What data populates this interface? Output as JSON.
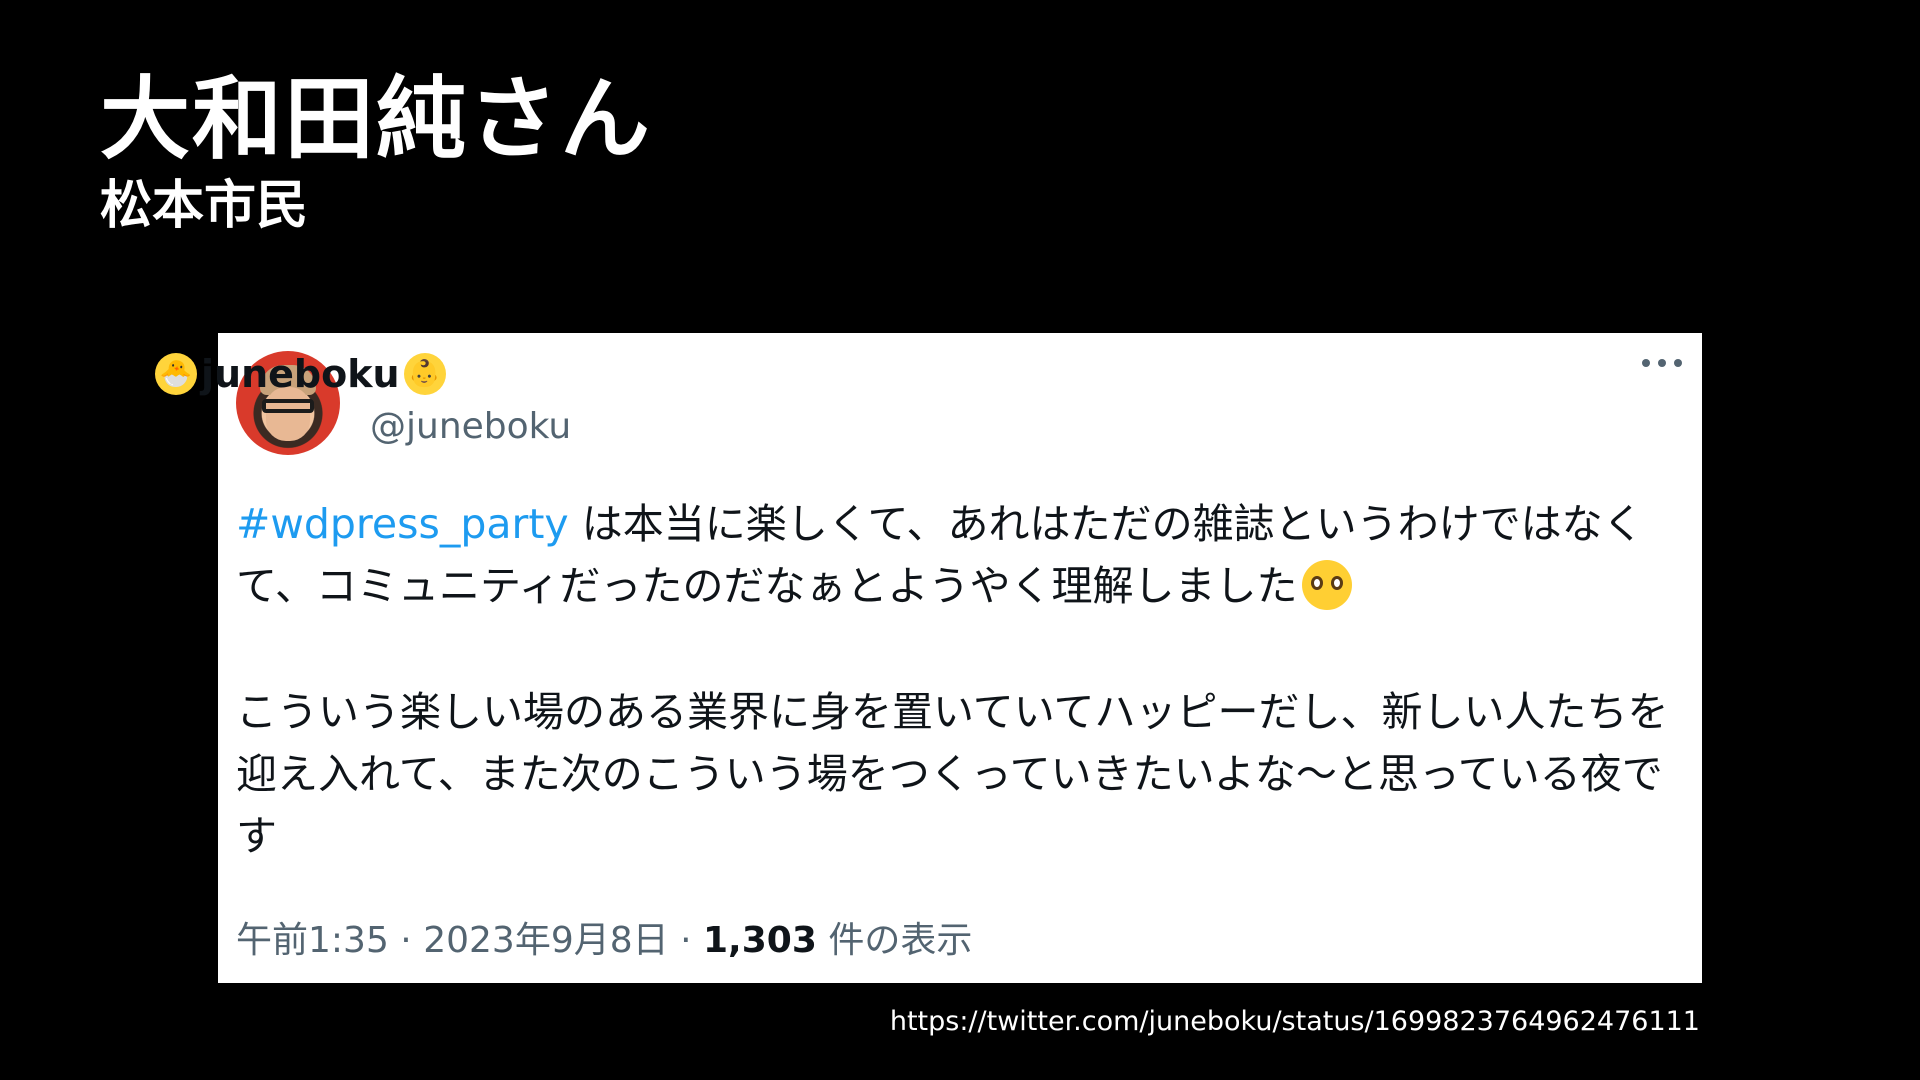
{
  "slide": {
    "title": "大和田純さん",
    "subtitle": "松本市民",
    "source_url": "https://twitter.com/juneboku/status/1699823764962476111"
  },
  "tweet": {
    "display_name": "juneboku",
    "name_emoji_left": "🐣",
    "name_emoji_right": "👶",
    "handle": "@juneboku",
    "hashtag": "#wdpress_party",
    "paragraph1_text": " は本当に楽しくて、あれはただの雑誌というわけではなくて、コミュニティだったのだなぁとようやく理解しました",
    "paragraph1_emoji": "🥹",
    "paragraph2": "こういう楽しい場のある業界に身を置いていてハッピーだし、新しい人たちを迎え入れて、また次のこういう場をつくっていきたいよな〜と思っている夜です",
    "time": "午前1:35",
    "separator": "·",
    "date": "2023年9月8日",
    "views_count": "1,303",
    "views_label": "件の表示"
  },
  "colors": {
    "background": "#000000",
    "card": "#ffffff",
    "text": "#0f1419",
    "muted": "#536471",
    "hashtag": "#1d9bf0"
  },
  "icons": {
    "more": "more-horizontal-icon",
    "avatar": "profile-avatar"
  }
}
